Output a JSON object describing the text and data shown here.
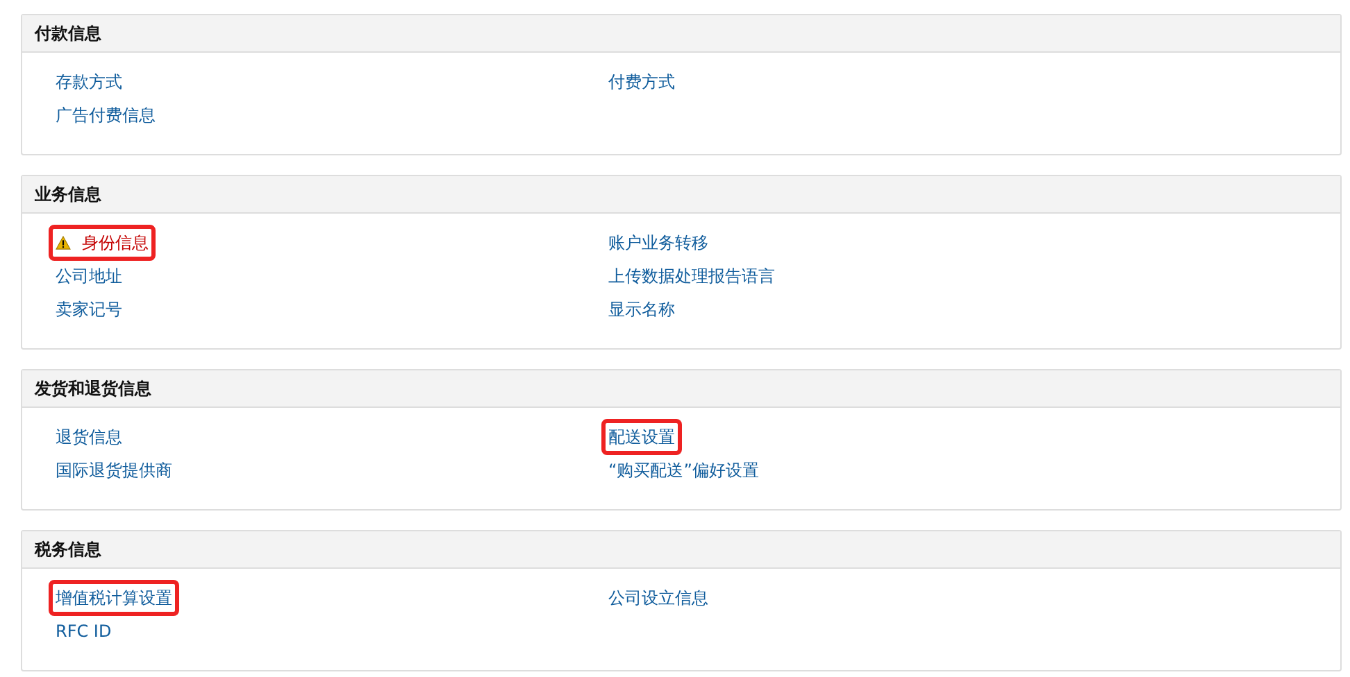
{
  "sections": [
    {
      "title": "付款信息",
      "left": [
        {
          "label": "存款方式",
          "highlighted": false,
          "warning": false
        },
        {
          "label": "广告付费信息",
          "highlighted": false,
          "warning": false
        }
      ],
      "right": [
        {
          "label": "付费方式",
          "highlighted": false,
          "warning": false
        }
      ]
    },
    {
      "title": "业务信息",
      "left": [
        {
          "label": "身份信息",
          "highlighted": true,
          "warning": true
        },
        {
          "label": "公司地址",
          "highlighted": false,
          "warning": false
        },
        {
          "label": "卖家记号",
          "highlighted": false,
          "warning": false
        }
      ],
      "right": [
        {
          "label": "账户业务转移",
          "highlighted": false,
          "warning": false
        },
        {
          "label": "上传数据处理报告语言",
          "highlighted": false,
          "warning": false
        },
        {
          "label": "显示名称",
          "highlighted": false,
          "warning": false
        }
      ]
    },
    {
      "title": "发货和退货信息",
      "left": [
        {
          "label": "退货信息",
          "highlighted": false,
          "warning": false
        },
        {
          "label": "国际退货提供商",
          "highlighted": false,
          "warning": false
        }
      ],
      "right": [
        {
          "label": "配送设置",
          "highlighted": true,
          "warning": false
        },
        {
          "label": "“购买配送”偏好设置",
          "highlighted": false,
          "warning": false
        }
      ]
    },
    {
      "title": "税务信息",
      "left": [
        {
          "label": "增值税计算设置",
          "highlighted": true,
          "warning": false
        },
        {
          "label": "RFC ID",
          "highlighted": false,
          "warning": false
        }
      ],
      "right": [
        {
          "label": "公司设立信息",
          "highlighted": false,
          "warning": false
        }
      ]
    }
  ]
}
